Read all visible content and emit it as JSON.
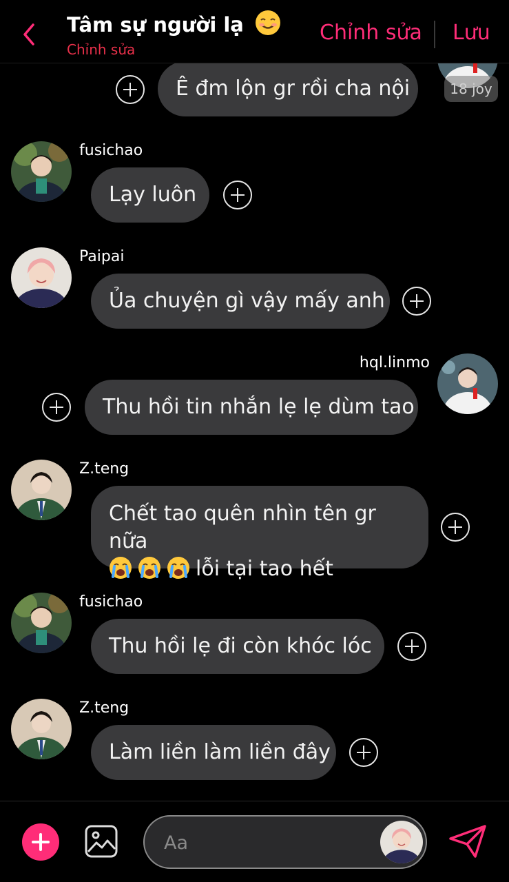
{
  "header": {
    "title": "Tâm sự người lạ",
    "subtitle": "Chỉnh sửa",
    "edit_label": "Chỉnh sửa",
    "save_label": "Lưu"
  },
  "badge": {
    "time": "18 joy"
  },
  "messages": [
    {
      "sender": "",
      "text": "Ê đm lộn gr rồi cha nội",
      "side": "right"
    },
    {
      "sender": "fusichao",
      "text": "Lạy luôn",
      "side": "left"
    },
    {
      "sender": "Paipai",
      "text": "Ủa chuyện gì vậy mấy anh",
      "side": "left"
    },
    {
      "sender": "hql.linmo",
      "text": "Thu hồi tin nhắn lẹ lẹ dùm tao",
      "side": "right"
    },
    {
      "sender": "Z.teng",
      "text": "Chết tao quên nhìn tên gr nữa",
      "text2": "lỗi tại tao hết",
      "side": "left"
    },
    {
      "sender": "fusichao",
      "text": "Thu hồi lẹ đi còn khóc lóc",
      "side": "left"
    },
    {
      "sender": "Z.teng",
      "text": "Làm liền làm liền đây",
      "side": "left"
    }
  ],
  "composer": {
    "placeholder": "Aa"
  },
  "colors": {
    "accent": "#ff2d78",
    "bubble": "#3a3a3c",
    "subtitle": "#e8304a",
    "background": "#000000"
  },
  "icons": [
    "back-chevron-icon",
    "smile-emoji-icon",
    "add-reaction-icon",
    "crying-emoji-icon",
    "plus-icon",
    "image-icon",
    "send-icon"
  ]
}
